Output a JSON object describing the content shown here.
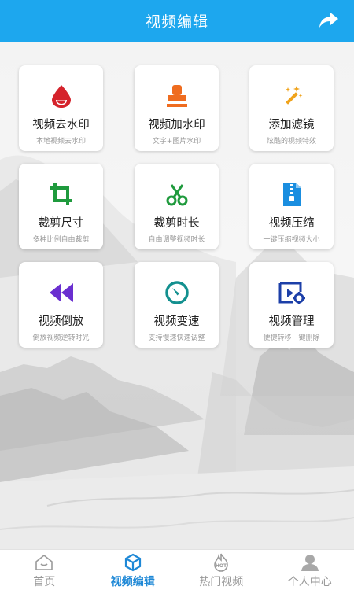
{
  "header": {
    "title": "视频编辑",
    "share_icon": "share-arrow-icon"
  },
  "colors": {
    "primary": "#1da7ee",
    "active_tab": "#1e88d6",
    "inactive_tab": "#9a9a9a"
  },
  "tools": [
    {
      "title": "视频去水印",
      "subtitle": "本地视频去水印",
      "icon": "water-drop-icon"
    },
    {
      "title": "视频加水印",
      "subtitle": "文字+图片水印",
      "icon": "stamp-icon"
    },
    {
      "title": "添加滤镜",
      "subtitle": "炫酷的视频特效",
      "icon": "magic-wand-icon"
    },
    {
      "title": "裁剪尺寸",
      "subtitle": "多种比例自由裁剪",
      "icon": "crop-icon"
    },
    {
      "title": "裁剪时长",
      "subtitle": "自由调整视频时长",
      "icon": "scissors-icon"
    },
    {
      "title": "视频压缩",
      "subtitle": "一键压缩视频大小",
      "icon": "zip-file-icon"
    },
    {
      "title": "视频倒放",
      "subtitle": "倒放视频逆转时光",
      "icon": "rewind-icon"
    },
    {
      "title": "视频变速",
      "subtitle": "支持慢速快速调整",
      "icon": "speedometer-icon"
    },
    {
      "title": "视频管理",
      "subtitle": "便捷转移一键删除",
      "icon": "video-settings-icon"
    }
  ],
  "tabbar": [
    {
      "label": "首页",
      "icon": "home-icon",
      "active": false
    },
    {
      "label": "视频编辑",
      "icon": "cube-icon",
      "active": true
    },
    {
      "label": "热门视频",
      "icon": "hot-icon",
      "active": false
    },
    {
      "label": "个人中心",
      "icon": "person-icon",
      "active": false
    }
  ]
}
